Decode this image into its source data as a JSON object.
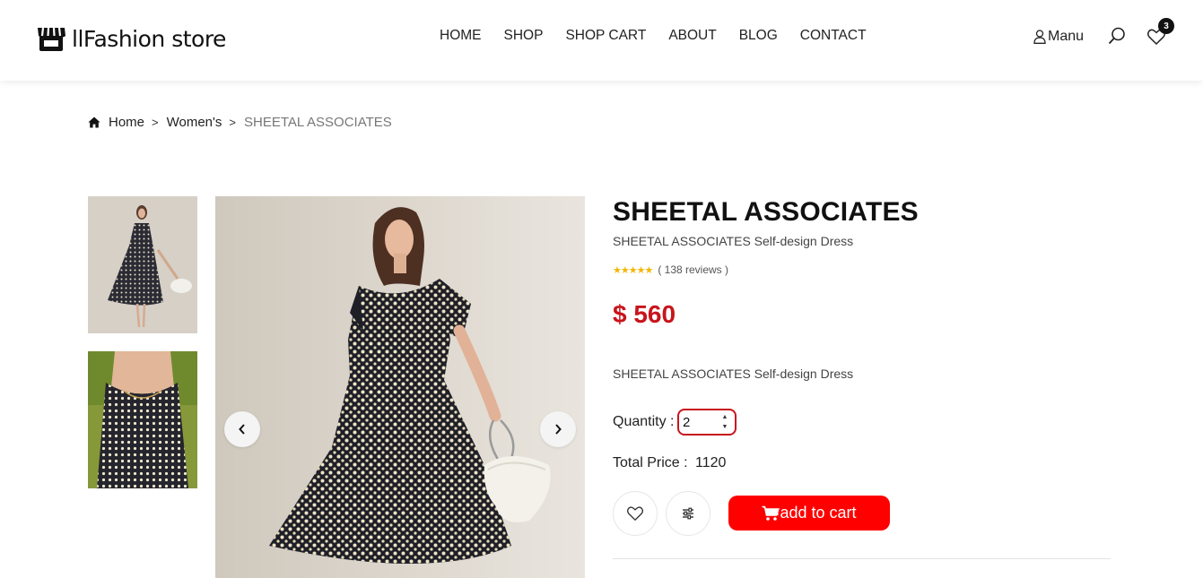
{
  "header": {
    "logo_text": "llFashion store",
    "nav": [
      "HOME",
      "SHOP",
      "SHOP CART",
      "ABOUT",
      "BLOG",
      "CONTACT"
    ],
    "user_label": "Manu",
    "wishlist_count": "3",
    "icons": {
      "logo": "store-icon",
      "user": "user-icon",
      "search": "search-icon",
      "wishlist": "heart-icon"
    }
  },
  "breadcrumb": {
    "home": "Home",
    "category": "Women's",
    "current": "SHEETAL ASSOCIATES",
    "separator": ">"
  },
  "product": {
    "title": "SHEETAL ASSOCIATES",
    "subtitle": "SHEETAL ASSOCIATES Self-design Dress",
    "stars": "★★★★★",
    "rating_value": 5,
    "reviews": "( 138 reviews )",
    "price": "$ 560",
    "description": "SHEETAL ASSOCIATES Self-design Dress",
    "quantity_label": "Quantity :",
    "quantity_value": "2",
    "total_label": "Total Price :",
    "total_value": "1120",
    "add_to_cart": "add to cart"
  },
  "gallery": {
    "thumbnails": [
      "thumbnail-full-dress",
      "thumbnail-closeup"
    ],
    "prev_icon": "chevron-left-icon",
    "next_icon": "chevron-right-icon"
  },
  "colors": {
    "accent_red": "#ff0000",
    "price_red": "#c8141c",
    "star_yellow": "#f2b705"
  }
}
